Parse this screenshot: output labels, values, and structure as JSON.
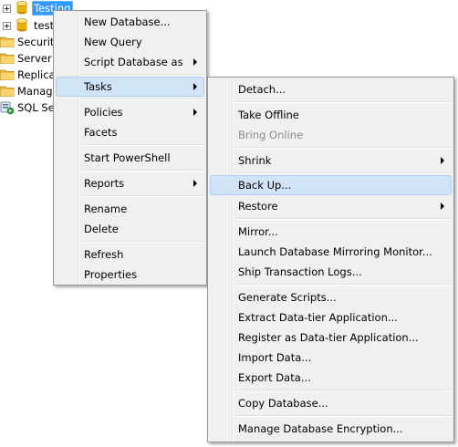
{
  "tree": {
    "databases": [
      "Testing",
      "test"
    ],
    "folders": [
      "Security",
      "Server O",
      "Replica",
      "Manag"
    ],
    "agent": "SQL Se"
  },
  "context_menu": {
    "new_database": "New Database...",
    "new_query": "New Query",
    "script_database_as": "Script Database as",
    "tasks": "Tasks",
    "policies": "Policies",
    "facets": "Facets",
    "start_powershell": "Start PowerShell",
    "reports": "Reports",
    "rename": "Rename",
    "delete": "Delete",
    "refresh": "Refresh",
    "properties": "Properties"
  },
  "tasks_menu": {
    "detach": "Detach...",
    "take_offline": "Take Offline",
    "bring_online": "Bring Online",
    "shrink": "Shrink",
    "back_up": "Back Up...",
    "restore": "Restore",
    "mirror": "Mirror...",
    "launch_mirroring_monitor": "Launch Database Mirroring Monitor...",
    "ship_transaction_logs": "Ship Transaction Logs...",
    "generate_scripts": "Generate Scripts...",
    "extract_data_tier": "Extract Data-tier Application...",
    "register_data_tier": "Register as Data-tier Application...",
    "import_data": "Import Data...",
    "export_data": "Export Data...",
    "copy_database": "Copy Database...",
    "manage_encryption": "Manage Database Encryption..."
  },
  "colors": {
    "selection": "#3399ff",
    "menu_highlight": "#d1e4f7",
    "menu_background": "#f0f0f0",
    "disabled_text": "#8d8d8d"
  },
  "icons": {
    "database": "database-icon",
    "folder": "folder-icon",
    "agent": "sql-agent-icon",
    "submenu": "submenu-arrow-icon"
  }
}
